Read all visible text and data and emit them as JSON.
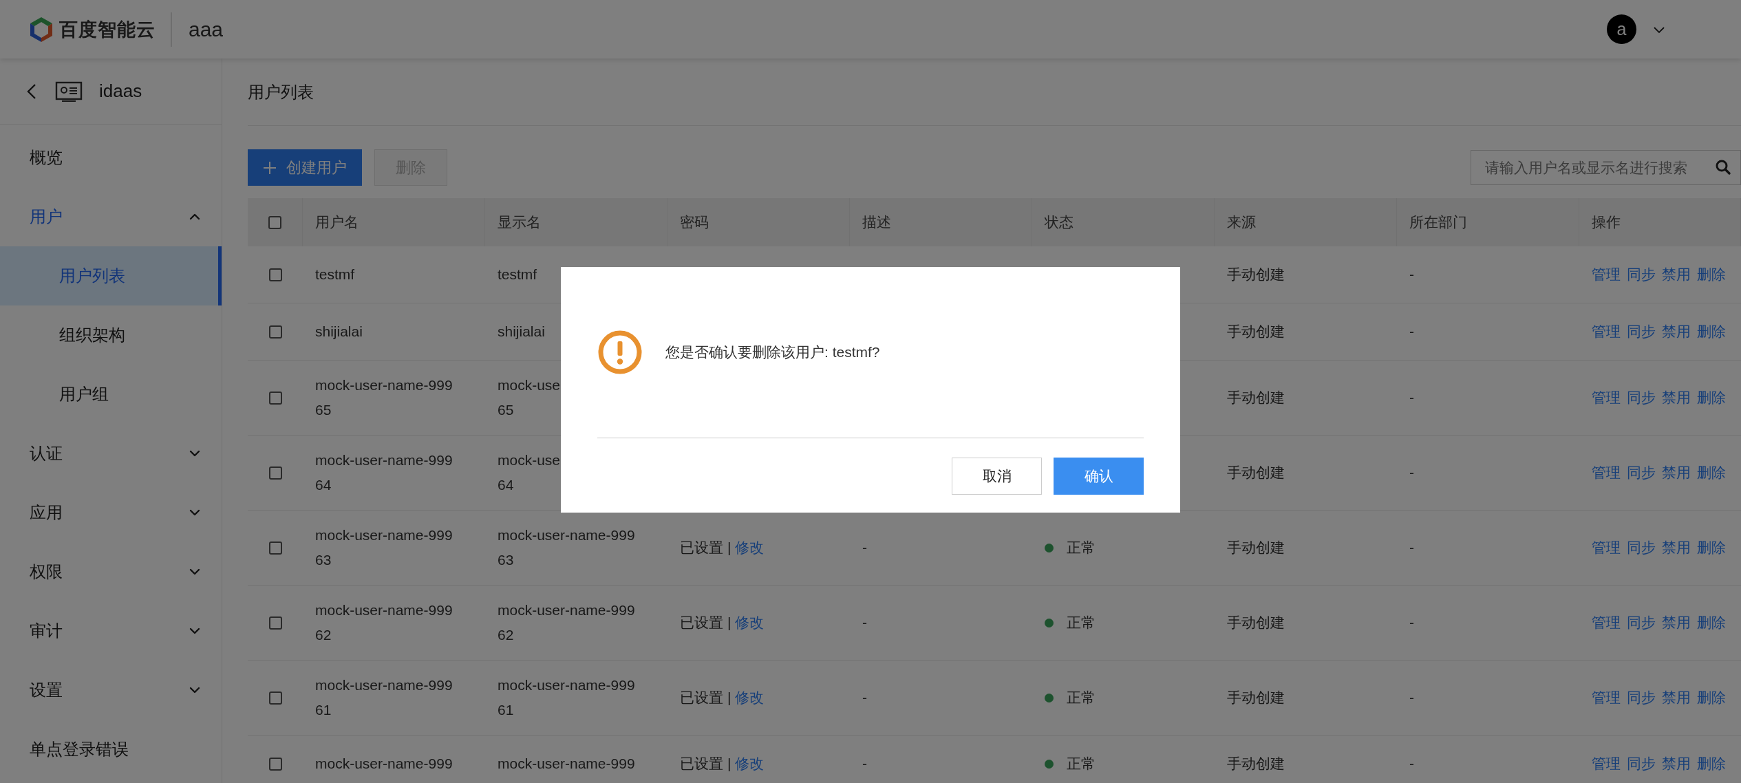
{
  "header": {
    "brand": "百度智能云",
    "project": "aaa",
    "avatar": "a"
  },
  "sidebar": {
    "back_title": "idaas",
    "items": [
      {
        "label": "概览",
        "selected": false
      },
      {
        "label": "用户",
        "selected": false,
        "expanded": true,
        "children": [
          {
            "label": "用户列表",
            "selected": true
          },
          {
            "label": "组织架构",
            "selected": false
          },
          {
            "label": "用户组",
            "selected": false
          }
        ]
      },
      {
        "label": "认证",
        "selected": false,
        "expanded": false
      },
      {
        "label": "应用",
        "selected": false,
        "expanded": false
      },
      {
        "label": "权限",
        "selected": false,
        "expanded": false
      },
      {
        "label": "审计",
        "selected": false,
        "expanded": false
      },
      {
        "label": "设置",
        "selected": false,
        "expanded": false
      },
      {
        "label": "单点登录错误",
        "selected": false
      }
    ]
  },
  "page": {
    "title": "用户列表",
    "create_button": "创建用户",
    "delete_button": {
      "label": "删除",
      "disabled": true
    },
    "search": {
      "placeholder": "请输入用户名或显示名进行搜索"
    }
  },
  "table": {
    "checked": false,
    "columns": [
      "用户名",
      "显示名",
      "密码",
      "描述",
      "状态",
      "来源",
      "所在部门",
      "操作"
    ],
    "rows": [
      {
        "checked": false,
        "username": "testmf",
        "display_name": "testmf",
        "source": "手动创建",
        "department": "-",
        "actions": [
          "管理",
          "同步",
          "禁用",
          "删除"
        ]
      },
      {
        "checked": false,
        "username": "shijialai",
        "display_name": "shijialai",
        "source": "手动创建",
        "department": "-",
        "actions": [
          "管理",
          "同步",
          "禁用",
          "删除"
        ]
      },
      {
        "checked": false,
        "username": "mock-user-name-99965",
        "display_name": "mock-use\n65",
        "source": "手动创建",
        "department": "-",
        "actions": [
          "管理",
          "同步",
          "禁用",
          "删除"
        ]
      },
      {
        "checked": false,
        "username": "mock-user-name-99964",
        "display_name": "mock-use\n64",
        "source": "手动创建",
        "department": "-",
        "actions": [
          "管理",
          "同步",
          "禁用",
          "删除"
        ]
      },
      {
        "checked": false,
        "username": "mock-user-name-99963",
        "display_name": "mock-user-name-99963",
        "password": {
          "status": "已设置",
          "separator": "|",
          "action": "修改"
        },
        "description": "-",
        "status": "正常",
        "source": "手动创建",
        "department": "-",
        "actions": [
          "管理",
          "同步",
          "禁用",
          "删除"
        ]
      },
      {
        "checked": false,
        "username": "mock-user-name-99962",
        "display_name": "mock-user-name-99962",
        "password": {
          "status": "已设置",
          "separator": "|",
          "action": "修改"
        },
        "description": "-",
        "status": "正常",
        "source": "手动创建",
        "department": "-",
        "actions": [
          "管理",
          "同步",
          "禁用",
          "删除"
        ]
      },
      {
        "checked": false,
        "username": "mock-user-name-99961",
        "display_name": "mock-user-name-99961",
        "password": {
          "status": "已设置",
          "separator": "|",
          "action": "修改"
        },
        "description": "-",
        "status": "正常",
        "source": "手动创建",
        "department": "-",
        "actions": [
          "管理",
          "同步",
          "禁用",
          "删除"
        ]
      },
      {
        "checked": false,
        "username": "mock-user-name-999",
        "display_name": "mock-user-name-999",
        "password": {
          "status": "已设置",
          "separator": "|",
          "action": "修改"
        },
        "description": "-",
        "status": "正常",
        "source": "手动创建",
        "department": "-",
        "actions": [
          "管理",
          "同步",
          "禁用",
          "删除"
        ]
      }
    ]
  },
  "dialog": {
    "message": "您是否确认要删除该用户: testmf?",
    "buttons": [
      {
        "label": "取消",
        "kind": "default"
      },
      {
        "label": "确认",
        "kind": "primary"
      }
    ]
  }
}
